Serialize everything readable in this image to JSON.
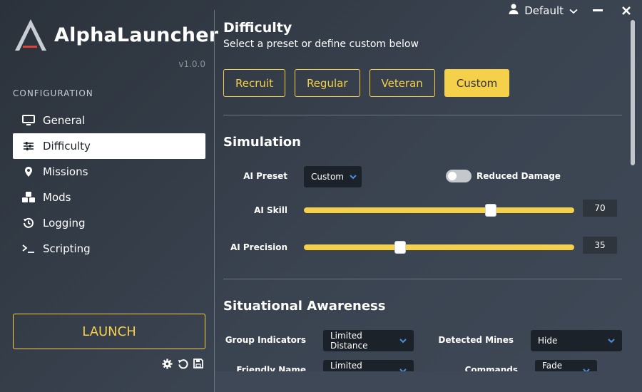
{
  "app": {
    "name": "AlphaLauncher",
    "version": "v1.0.0"
  },
  "topbar": {
    "profile": "Default"
  },
  "sidebar": {
    "section_label": "CONFIGURATION",
    "items": [
      {
        "label": "General",
        "icon": "monitor-icon"
      },
      {
        "label": "Difficulty",
        "icon": "sliders-icon",
        "active": true
      },
      {
        "label": "Missions",
        "icon": "map-pin-icon"
      },
      {
        "label": "Mods",
        "icon": "cubes-icon"
      },
      {
        "label": "Logging",
        "icon": "history-icon"
      },
      {
        "label": "Scripting",
        "icon": "terminal-icon"
      }
    ],
    "launch_label": "LAUNCH"
  },
  "main": {
    "title": "Difficulty",
    "subtitle": "Select a preset or define custom below",
    "presets": [
      "Recruit",
      "Regular",
      "Veteran",
      "Custom"
    ],
    "active_preset": "Custom",
    "simulation": {
      "heading": "Simulation",
      "ai_preset_label": "AI Preset",
      "ai_preset_value": "Custom",
      "reduced_damage_label": "Reduced Damage",
      "reduced_damage_on": false,
      "ai_skill_label": "AI Skill",
      "ai_skill_value": "70",
      "ai_precision_label": "AI Precision",
      "ai_precision_value": "35"
    },
    "awareness": {
      "heading": "Situational Awareness",
      "group_indicators_label": "Group Indicators",
      "group_indicators_value": "Limited Distance",
      "detected_mines_label": "Detected Mines",
      "detected_mines_value": "Hide",
      "friendly_name_tags_label": "Friendly Name Tags",
      "friendly_name_tags_value": "Limited Distance",
      "commands_label": "Commands",
      "commands_value": "Fade out"
    }
  },
  "colors": {
    "accent": "#f5d04a",
    "background": "#353d48",
    "select_bg": "#1c2229",
    "chevron": "#4b8fe0"
  }
}
